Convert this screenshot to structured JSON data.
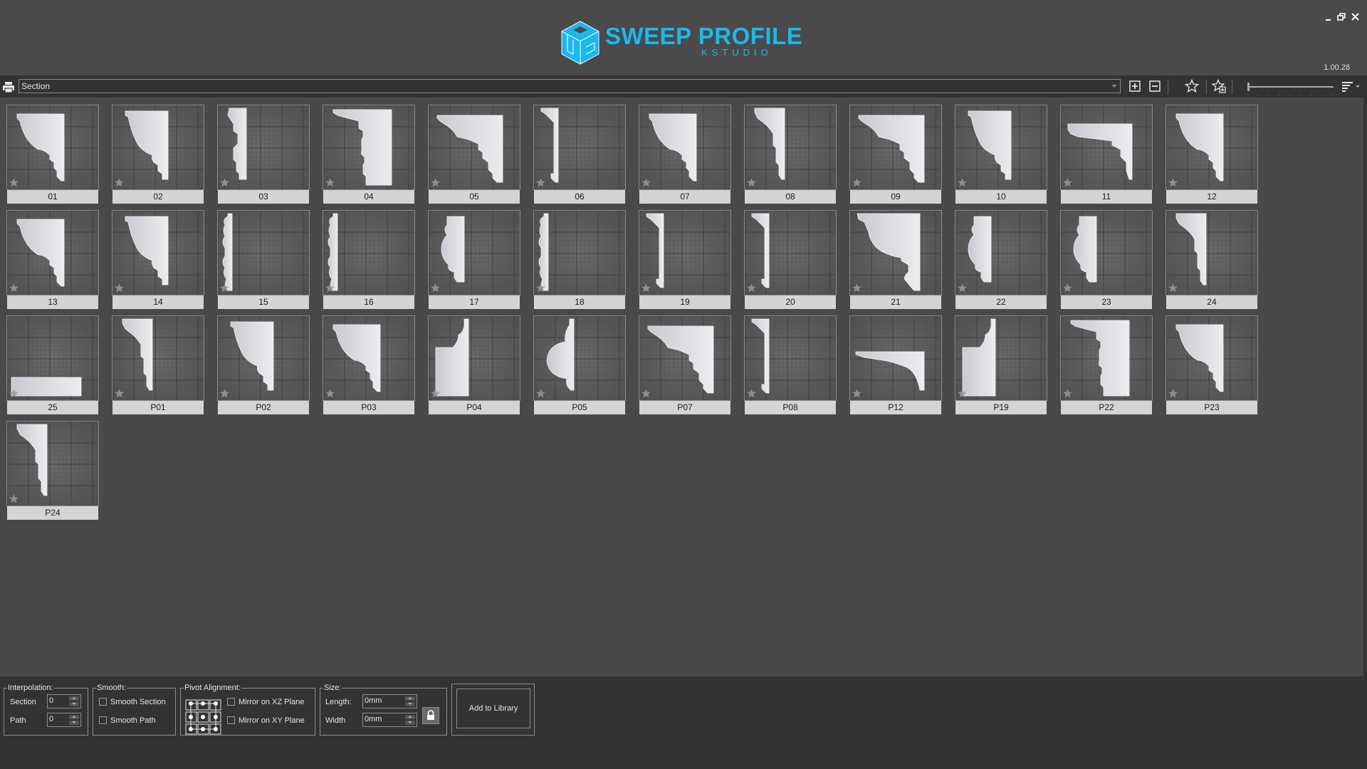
{
  "app": {
    "title": "SWEEP PROFILE",
    "subtitle": "KSTUDIO",
    "version": "1.00.28",
    "brand_color": "#1bb8ee",
    "window_controls": {
      "minimize": "minimize-icon",
      "restore": "restore-icon",
      "close": "close-icon"
    }
  },
  "toolbar": {
    "category": "Section",
    "buttons": [
      "expand-all",
      "collapse-all",
      "favorites",
      "add-favorite",
      "sort"
    ],
    "zoom_slider": 0.0
  },
  "library": {
    "items": [
      {
        "label": "01",
        "shape": "cornice-a"
      },
      {
        "label": "02",
        "shape": "cornice-b"
      },
      {
        "label": "03",
        "shape": "stepped-narrow"
      },
      {
        "label": "04",
        "shape": "stepped-tall"
      },
      {
        "label": "05",
        "shape": "cornice-wide"
      },
      {
        "label": "06",
        "shape": "pilaster"
      },
      {
        "label": "07",
        "shape": "cornice-a"
      },
      {
        "label": "08",
        "shape": "cornice-narrow"
      },
      {
        "label": "09",
        "shape": "cornice-wide"
      },
      {
        "label": "10",
        "shape": "cornice-b"
      },
      {
        "label": "11",
        "shape": "cornice-flat"
      },
      {
        "label": "12",
        "shape": "cornice-a"
      },
      {
        "label": "13",
        "shape": "cornice-a"
      },
      {
        "label": "14",
        "shape": "cornice-b"
      },
      {
        "label": "15",
        "shape": "thin-strip"
      },
      {
        "label": "16",
        "shape": "thin-strip"
      },
      {
        "label": "17",
        "shape": "baluster"
      },
      {
        "label": "18",
        "shape": "thin-strip"
      },
      {
        "label": "19",
        "shape": "pilaster"
      },
      {
        "label": "20",
        "shape": "pilaster"
      },
      {
        "label": "21",
        "shape": "cornice-round"
      },
      {
        "label": "22",
        "shape": "baluster"
      },
      {
        "label": "23",
        "shape": "baluster"
      },
      {
        "label": "24",
        "shape": "cornice-narrow"
      },
      {
        "label": "25",
        "shape": "base-low"
      },
      {
        "label": "P01",
        "shape": "cornice-narrow"
      },
      {
        "label": "P02",
        "shape": "cornice-b"
      },
      {
        "label": "P03",
        "shape": "cornice-a"
      },
      {
        "label": "P04",
        "shape": "block-cap"
      },
      {
        "label": "P05",
        "shape": "half-round"
      },
      {
        "label": "P07",
        "shape": "cornice-wide"
      },
      {
        "label": "P08",
        "shape": "pilaster"
      },
      {
        "label": "P12",
        "shape": "shelf"
      },
      {
        "label": "P19",
        "shape": "block-cap"
      },
      {
        "label": "P22",
        "shape": "stepped-tall"
      },
      {
        "label": "P23",
        "shape": "cornice-a"
      },
      {
        "label": "P24",
        "shape": "cornice-narrow"
      }
    ]
  },
  "interpolation": {
    "title": "Interpolation:",
    "section_label": "Section",
    "section_value": "0",
    "path_label": "Path",
    "path_value": "0"
  },
  "smooth": {
    "title": "Smooth:",
    "smooth_section": "Smooth Section",
    "smooth_section_checked": false,
    "smooth_path": "Smooth Path",
    "smooth_path_checked": false
  },
  "pivot": {
    "title": "Pivot Alignment:",
    "mirror_xz": "Mirror on XZ Plane",
    "mirror_xz_checked": false,
    "mirror_xy": "Mirror on XY Plane",
    "mirror_xy_checked": false
  },
  "size": {
    "title": "Size:",
    "length_label": "Length:",
    "length_value": "0mm",
    "width_label": "Width",
    "width_value": "0mm",
    "lock": "lock-icon"
  },
  "actions": {
    "add_to_library": "Add to Library"
  }
}
